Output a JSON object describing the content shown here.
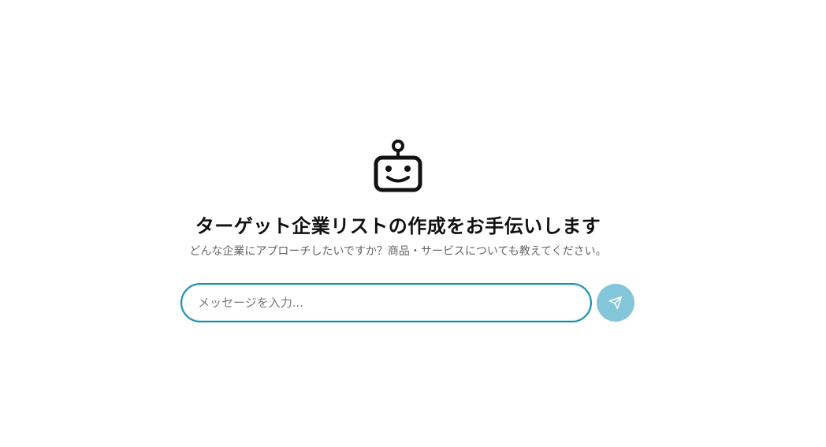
{
  "hero": {
    "icon": "robot-icon",
    "title": "ターゲット企業リストの作成をお手伝いします",
    "subtitle": "どんな企業にアプローチしたいですか？商品・サービスについても教えてください。"
  },
  "composer": {
    "placeholder": "メッセージを入力...",
    "value": "",
    "send_icon": "send-icon"
  },
  "colors": {
    "input_border": "#1b8fab",
    "send_button": "#83c6d9",
    "title": "#111111",
    "subtitle": "#666666"
  }
}
